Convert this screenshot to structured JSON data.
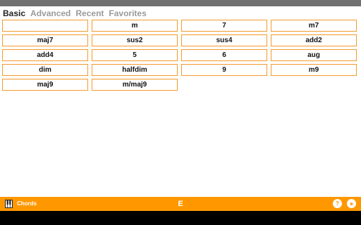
{
  "tabs": [
    {
      "label": "Basic",
      "active": true
    },
    {
      "label": "Advanced",
      "active": false
    },
    {
      "label": "Recent",
      "active": false
    },
    {
      "label": "Favorites",
      "active": false
    }
  ],
  "chords": [
    "",
    "m",
    "7",
    "m7",
    "maj7",
    "sus2",
    "sus4",
    "add2",
    "add4",
    "5",
    "6",
    "aug",
    "dim",
    "halfdim",
    "9",
    "m9",
    "maj9",
    "m/maj9"
  ],
  "bottom_bar": {
    "section_label": "Chords",
    "key": "E",
    "help_label": "?",
    "icons": [
      "piano-icon",
      "help-icon",
      "play-icon"
    ]
  },
  "colors": {
    "accent": "#ff9800",
    "button_border": "#f39a2c",
    "active_tab": "#222222",
    "inactive_tab": "#9a9a9a",
    "status_bar": "#707070"
  }
}
